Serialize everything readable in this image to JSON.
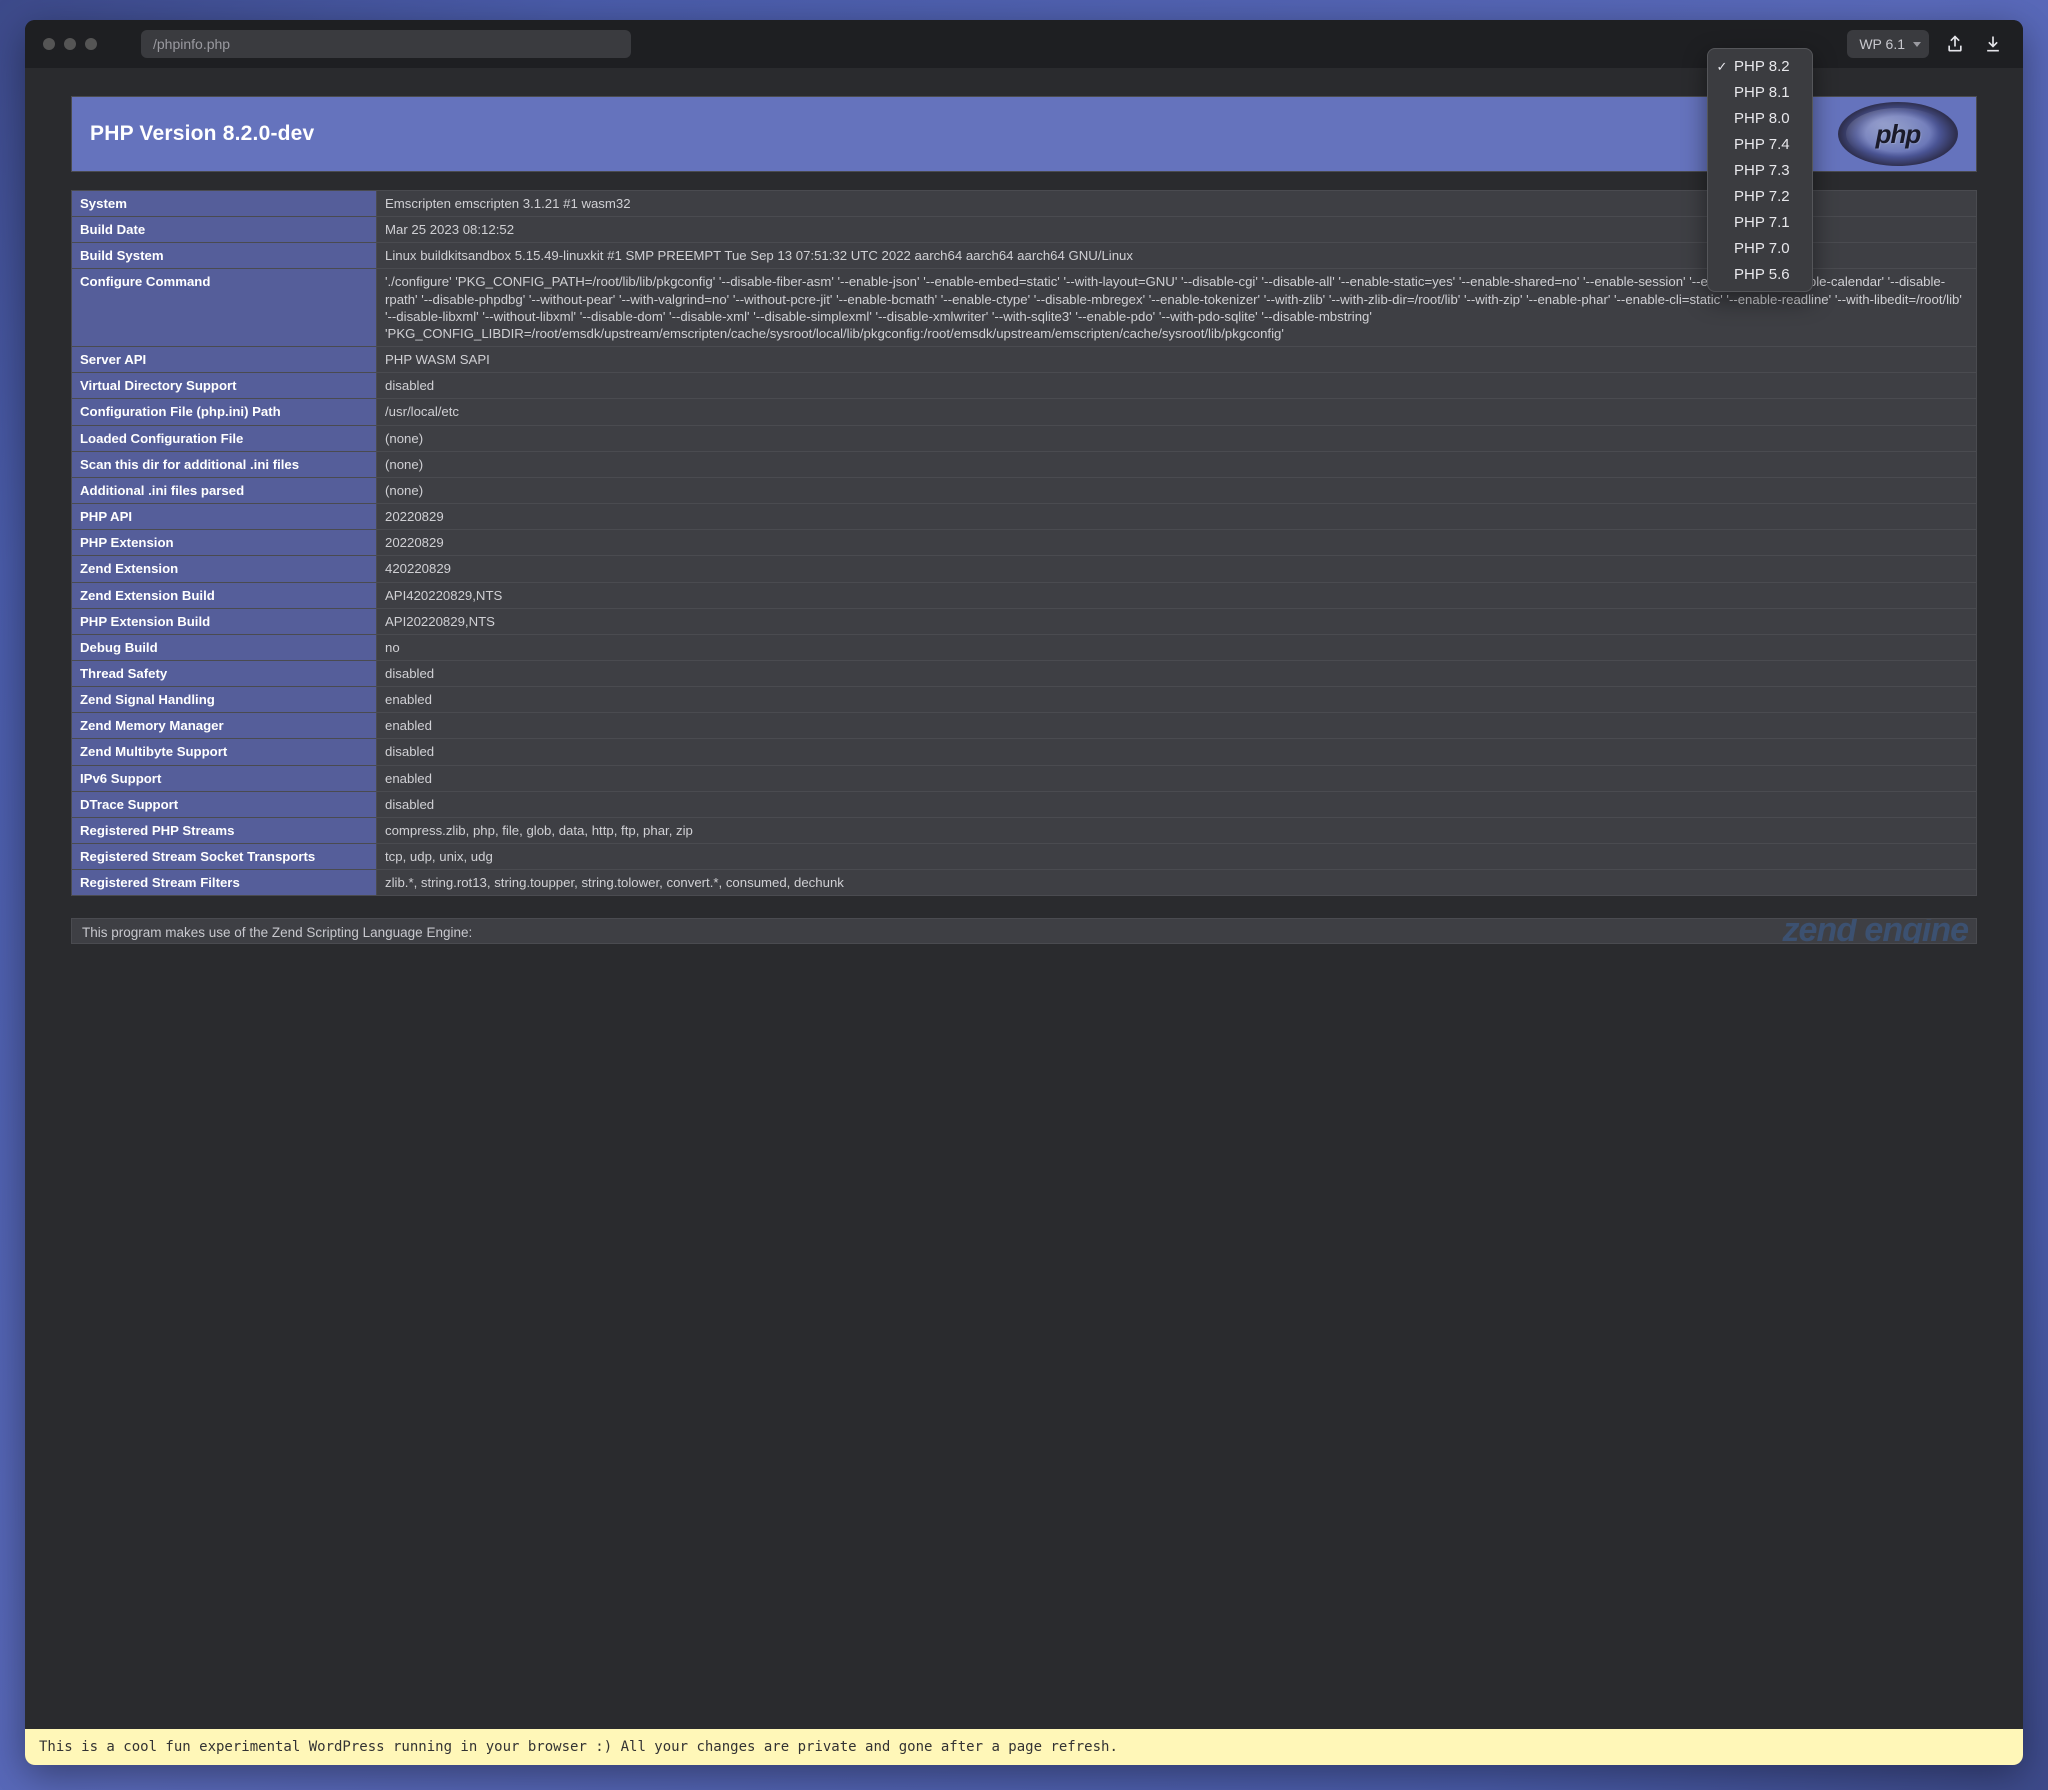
{
  "url": "/phpinfo.php",
  "php_selector_visible": "PHP 8.2",
  "wp_selector": "WP 6.1",
  "php_versions": [
    {
      "label": "PHP 8.2",
      "selected": true
    },
    {
      "label": "PHP 8.1",
      "selected": false
    },
    {
      "label": "PHP 8.0",
      "selected": false
    },
    {
      "label": "PHP 7.4",
      "selected": false
    },
    {
      "label": "PHP 7.3",
      "selected": false
    },
    {
      "label": "PHP 7.2",
      "selected": false
    },
    {
      "label": "PHP 7.1",
      "selected": false
    },
    {
      "label": "PHP 7.0",
      "selected": false
    },
    {
      "label": "PHP 5.6",
      "selected": false
    }
  ],
  "banner_title": "PHP Version 8.2.0-dev",
  "php_logo_text": "php",
  "rows": [
    {
      "k": "System",
      "v": "Emscripten emscripten 3.1.21 #1 wasm32"
    },
    {
      "k": "Build Date",
      "v": "Mar 25 2023 08:12:52"
    },
    {
      "k": "Build System",
      "v": "Linux buildkitsandbox 5.15.49-linuxkit #1 SMP PREEMPT Tue Sep 13 07:51:32 UTC 2022 aarch64 aarch64 aarch64 GNU/Linux"
    },
    {
      "k": "Configure Command",
      "v": "'./configure' 'PKG_CONFIG_PATH=/root/lib/lib/pkgconfig' '--disable-fiber-asm' '--enable-json' '--enable-embed=static' '--with-layout=GNU' '--disable-cgi' '--disable-all' '--enable-static=yes' '--enable-shared=no' '--enable-session' '--enable-filter' '--enable-calendar' '--disable-rpath' '--disable-phpdbg' '--without-pear' '--with-valgrind=no' '--without-pcre-jit' '--enable-bcmath' '--enable-ctype' '--disable-mbregex' '--enable-tokenizer' '--with-zlib' '--with-zlib-dir=/root/lib' '--with-zip' '--enable-phar' '--enable-cli=static' '--enable-readline' '--with-libedit=/root/lib' '--disable-libxml' '--without-libxml' '--disable-dom' '--disable-xml' '--disable-simplexml' '--disable-xmlwriter' '--with-sqlite3' '--enable-pdo' '--with-pdo-sqlite' '--disable-mbstring' 'PKG_CONFIG_LIBDIR=/root/emsdk/upstream/emscripten/cache/sysroot/local/lib/pkgconfig:/root/emsdk/upstream/emscripten/cache/sysroot/lib/pkgconfig'"
    },
    {
      "k": "Server API",
      "v": "PHP WASM SAPI"
    },
    {
      "k": "Virtual Directory Support",
      "v": "disabled"
    },
    {
      "k": "Configuration File (php.ini) Path",
      "v": "/usr/local/etc"
    },
    {
      "k": "Loaded Configuration File",
      "v": "(none)"
    },
    {
      "k": "Scan this dir for additional .ini files",
      "v": "(none)"
    },
    {
      "k": "Additional .ini files parsed",
      "v": "(none)"
    },
    {
      "k": "PHP API",
      "v": "20220829"
    },
    {
      "k": "PHP Extension",
      "v": "20220829"
    },
    {
      "k": "Zend Extension",
      "v": "420220829"
    },
    {
      "k": "Zend Extension Build",
      "v": "API420220829,NTS"
    },
    {
      "k": "PHP Extension Build",
      "v": "API20220829,NTS"
    },
    {
      "k": "Debug Build",
      "v": "no"
    },
    {
      "k": "Thread Safety",
      "v": "disabled"
    },
    {
      "k": "Zend Signal Handling",
      "v": "enabled"
    },
    {
      "k": "Zend Memory Manager",
      "v": "enabled"
    },
    {
      "k": "Zend Multibyte Support",
      "v": "disabled"
    },
    {
      "k": "IPv6 Support",
      "v": "enabled"
    },
    {
      "k": "DTrace Support",
      "v": "disabled"
    },
    {
      "k": "Registered PHP Streams",
      "v": "compress.zlib, php, file, glob, data, http, ftp, phar, zip"
    },
    {
      "k": "Registered Stream Socket Transports",
      "v": "tcp, udp, unix, udg"
    },
    {
      "k": "Registered Stream Filters",
      "v": "zlib.*, string.rot13, string.toupper, string.tolower, convert.*, consumed, dechunk"
    }
  ],
  "zend_text": "This program makes use of the Zend Scripting Language Engine:",
  "zend_watermark": "zend engine",
  "footer": "This is a cool fun experimental WordPress running in your browser :) All your changes are private and gone after a page refresh."
}
